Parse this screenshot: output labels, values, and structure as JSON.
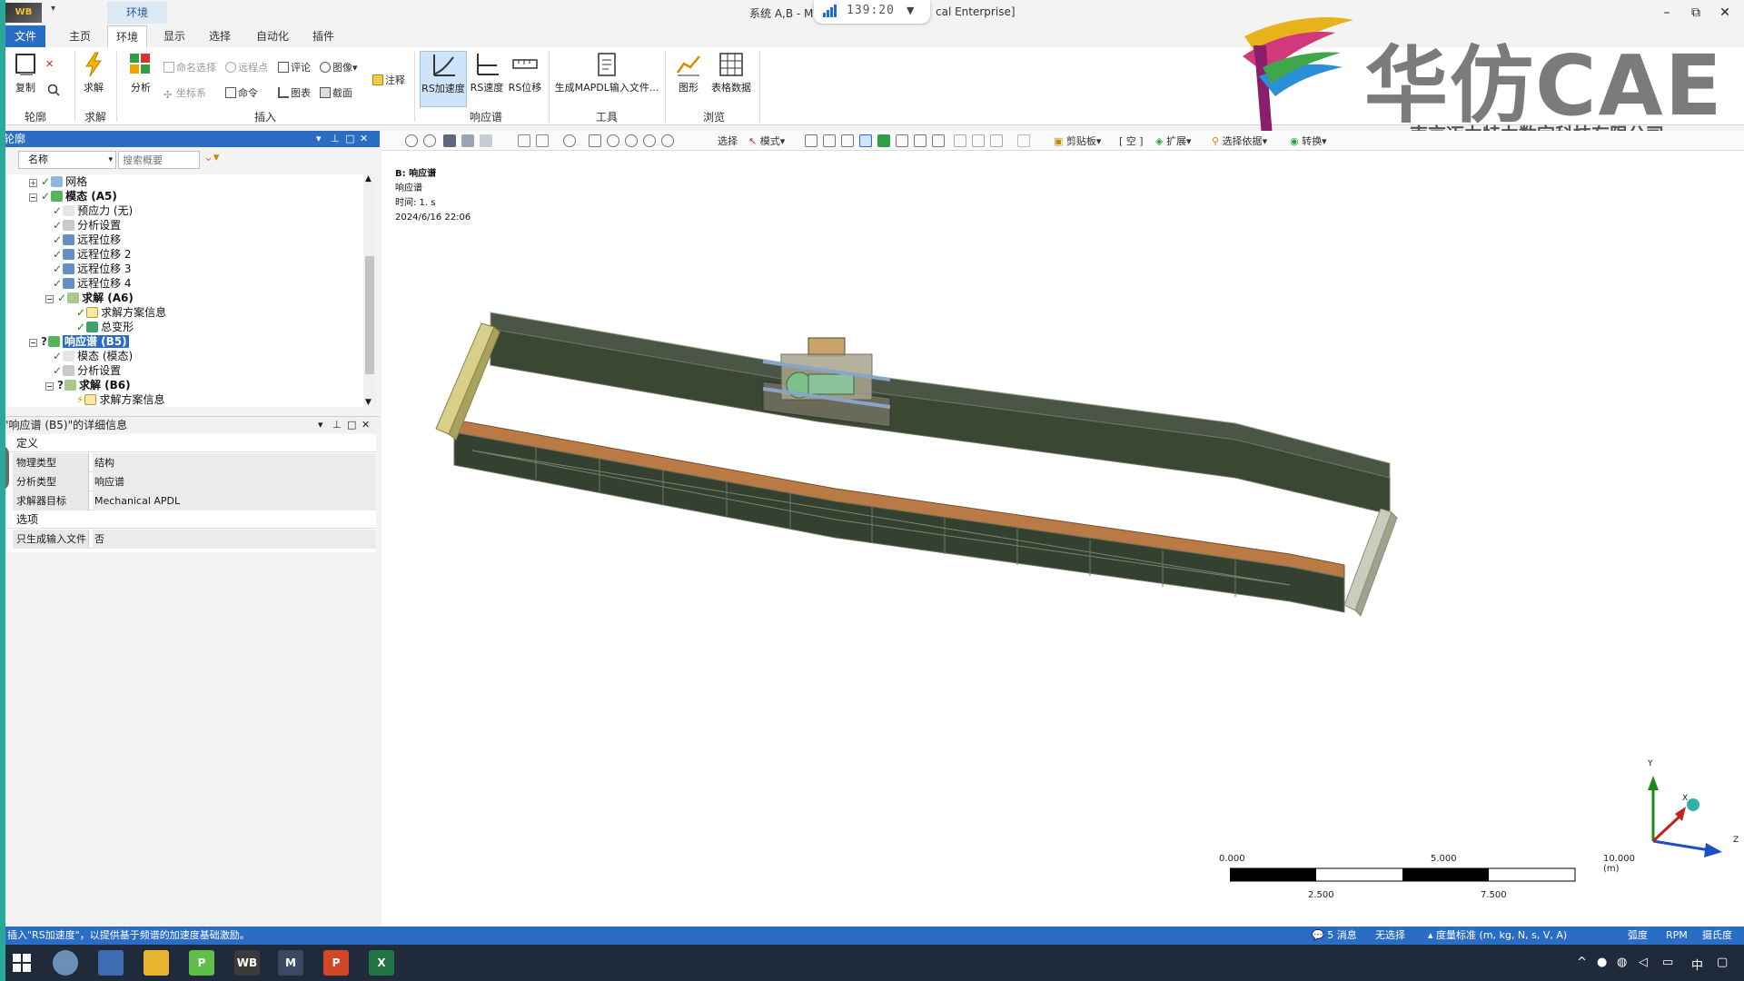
{
  "titlebar": {
    "logo_text": "WB",
    "context_tab": "环境",
    "title_left": "系统 A,B - Me",
    "title_right": "cal Enterprise]",
    "timer": "139:20",
    "buttons": {
      "minimize": "–",
      "restore": "⧉",
      "close": "✕"
    }
  },
  "ribbon_tabs": [
    "文件",
    "主页",
    "环境",
    "显示",
    "选择",
    "自动化",
    "插件"
  ],
  "ribbon": {
    "outline_group": {
      "label": "轮廓",
      "copy_label": "复制"
    },
    "solve_group": {
      "label": "求解",
      "solve_label": "求解"
    },
    "insert_group": {
      "label": "插入",
      "analysis_label": "分析",
      "named_selection": "命名选择",
      "remote_point": "远程点",
      "comment": "评论",
      "image": "图像",
      "annotation": "注释",
      "coordinate_system": "坐标系",
      "command": "命令",
      "chart": "图表",
      "section": "截面"
    },
    "rs_group": {
      "label": "响应谱",
      "rs_accel": "RS加速度",
      "rs_velocity": "RS速度",
      "rs_displacement": "RS位移"
    },
    "tools_group": {
      "label": "工具",
      "gen_mapdl": "生成MAPDL输入文件..."
    },
    "browse_group": {
      "label": "浏览",
      "graph": "图形",
      "table_data": "表格数据"
    }
  },
  "brand": {
    "title": "华仿CAE",
    "subtitle": "南京迈力特力数字科技有限公司"
  },
  "outline": {
    "title": "轮廓",
    "filter_select": "名称",
    "search_placeholder": "搜索概要",
    "nodes": [
      {
        "label": "网格"
      },
      {
        "label": "模态 (A5)"
      },
      {
        "label": "预应力 (无)"
      },
      {
        "label": "分析设置"
      },
      {
        "label": "远程位移"
      },
      {
        "label": "远程位移 2"
      },
      {
        "label": "远程位移 3"
      },
      {
        "label": "远程位移 4"
      },
      {
        "label": "求解 (A6)"
      },
      {
        "label": "求解方案信息"
      },
      {
        "label": "总变形"
      },
      {
        "label": "响应谱 (B5)"
      },
      {
        "label": "模态 (模态)"
      },
      {
        "label": "分析设置"
      },
      {
        "label": "求解 (B6)"
      },
      {
        "label": "求解方案信息"
      }
    ]
  },
  "details": {
    "title": "\"响应谱 (B5)\"的详细信息",
    "sections": [
      {
        "name": "定义",
        "rows": [
          {
            "key": "物理类型",
            "value": "结构"
          },
          {
            "key": "分析类型",
            "value": "响应谱"
          },
          {
            "key": "求解器目标",
            "value": "Mechanical APDL"
          }
        ]
      },
      {
        "name": "选项",
        "rows": [
          {
            "key": "只生成输入文件",
            "value": "否"
          }
        ]
      }
    ]
  },
  "gfx_toolbar": {
    "select": "选择",
    "mode": "模式",
    "clipboard": "剪贴板",
    "empty": "[ 空 ]",
    "extend": "扩展",
    "select_by": "选择依据",
    "convert": "转换"
  },
  "viewport": {
    "info_title": "B: 响应谱",
    "info_type": "响应谱",
    "info_time": "时间: 1. s",
    "info_date": "2024/6/16 22:06",
    "scale_top": [
      "0.000",
      "5.000",
      "10.000 (m)"
    ],
    "scale_bottom": [
      "2.500",
      "7.500"
    ],
    "triad": {
      "x": "X",
      "y": "Y",
      "z": "Z"
    }
  },
  "status": {
    "hint": "插入\"RS加速度\"，以提供基于频谱的加速度基础激励。",
    "messages": "5 消息",
    "selection": "无选择",
    "units": "度量标准 (m, kg, N, s, V, A)",
    "angle": "弧度",
    "rpm": "RPM",
    "temp": "摄氏度"
  },
  "taskbar": {
    "apps": [
      "P",
      "WB",
      "M",
      "P",
      "X"
    ],
    "time_lang": "中"
  },
  "colors": {
    "accent": "#2b6cc4",
    "beam_green": "#3a4733",
    "beam_orange": "#b97a45"
  }
}
